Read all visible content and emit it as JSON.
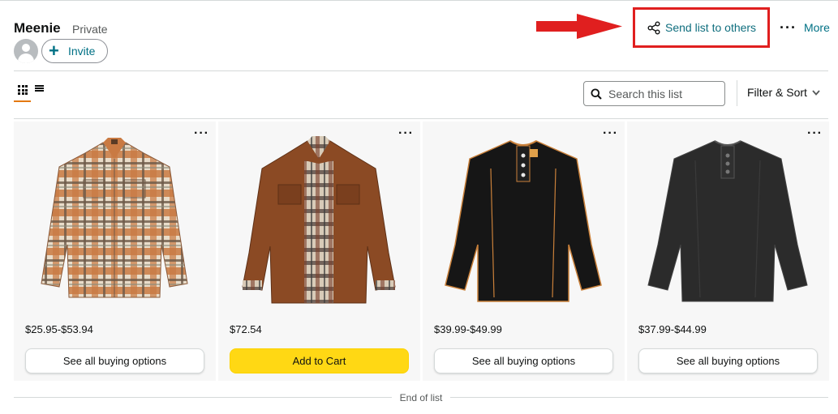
{
  "list": {
    "name": "Meenie",
    "privacy": "Private",
    "invite_label": "Invite"
  },
  "actions": {
    "send_list_label": "Send list to others",
    "more_label": "More"
  },
  "toolbar": {
    "search_placeholder": "Search this list",
    "filter_sort_label": "Filter & Sort"
  },
  "colors": {
    "link": "#007185",
    "highlight": "#e01f1f",
    "add_to_cart": "#ffd814",
    "active_tab": "#e47911"
  },
  "items": [
    {
      "image": "plaid-flannel-shirt",
      "price": "$25.95-$53.94",
      "button": "See all buying options"
    },
    {
      "image": "brown-shirt-jacket",
      "price": "$72.54",
      "button": "Add to Cart"
    },
    {
      "image": "black-henley-shirt",
      "price": "$39.99-$49.99",
      "button": "See all buying options"
    },
    {
      "image": "charcoal-henley-shirt",
      "price": "$37.99-$44.99",
      "button": "See all buying options"
    }
  ],
  "footer": {
    "end_label": "End of list"
  }
}
